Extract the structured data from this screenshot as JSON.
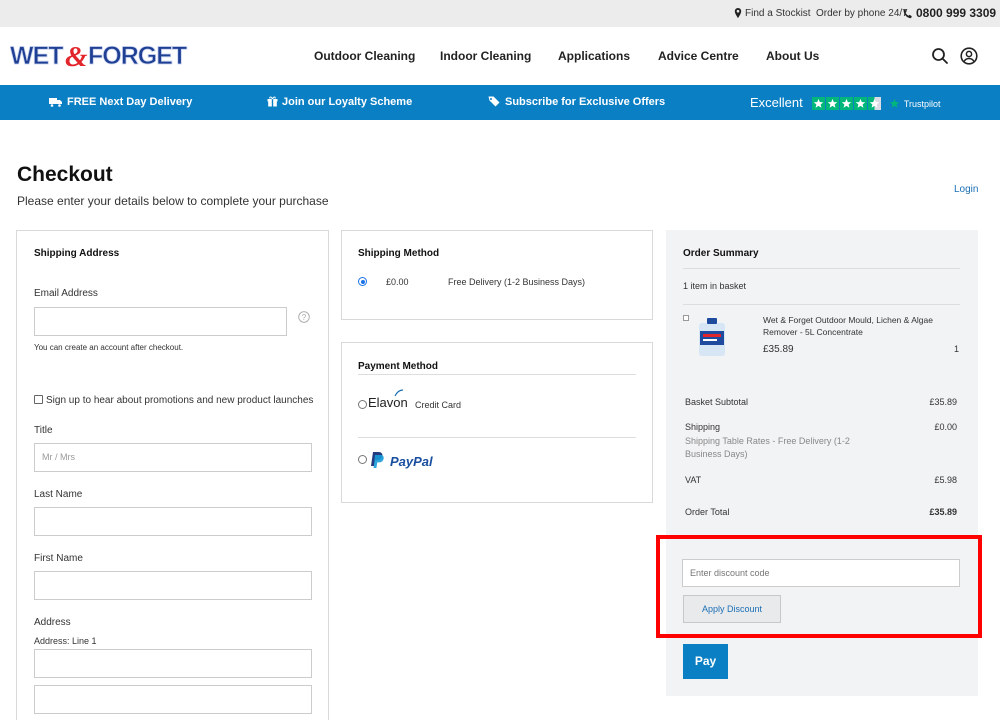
{
  "topbar": {
    "stockist": "Find a Stockist",
    "order_by_phone": "Order by phone 24/7",
    "phone": "0800 999 3309"
  },
  "header": {
    "logo_text": "WET&FORGET",
    "nav": [
      "Outdoor Cleaning",
      "Indoor Cleaning",
      "Applications",
      "Advice Centre",
      "About Us"
    ],
    "icons": [
      "search-icon",
      "account-icon"
    ]
  },
  "promo": {
    "delivery": "FREE Next Day Delivery",
    "loyalty": "Join our Loyalty Scheme",
    "offers": "Subscribe for Exclusive Offers",
    "rating_word": "Excellent",
    "trustpilot": "Trustpilot",
    "star_color": "#00b67a",
    "bar_color": "#0a7fc4"
  },
  "page": {
    "title": "Checkout",
    "subtitle": "Please enter your details below to complete your purchase",
    "login": "Login"
  },
  "shipping_address": {
    "title": "Shipping Address",
    "email_label": "Email Address",
    "email_value": "",
    "email_hint": "You can create an account after checkout.",
    "newsletter_label": "Sign up to hear about promotions and new product launches",
    "title_label": "Title",
    "title_placeholder": "Mr / Mrs",
    "last_name_label": "Last Name",
    "first_name_label": "First Name",
    "address_label": "Address",
    "address_line1_label": "Address: Line 1"
  },
  "shipping_method": {
    "title": "Shipping Method",
    "price": "£0.00",
    "name": "Free Delivery (1-2 Business Days)"
  },
  "payment_method": {
    "title": "Payment Method",
    "elavon_logo": "Elavon",
    "elavon_label": "Credit Card",
    "paypal_logo": "PayPal"
  },
  "order_summary": {
    "title": "Order Summary",
    "count": "1 item in basket",
    "item": {
      "name": "Wet & Forget Outdoor Mould, Lichen & Algae Remover - 5L Concentrate",
      "price": "£35.89",
      "qty": "1"
    },
    "subtotal_label": "Basket Subtotal",
    "subtotal": "£35.89",
    "shipping_label": "Shipping",
    "shipping_detail": "Shipping Table Rates - Free Delivery (1-2 Business Days)",
    "shipping": "£0.00",
    "vat_label": "VAT",
    "vat": "£5.98",
    "total_label": "Order Total",
    "total": "£35.89",
    "discount_placeholder": "Enter discount code",
    "apply_label": "Apply Discount",
    "pay_label": "Pay"
  }
}
